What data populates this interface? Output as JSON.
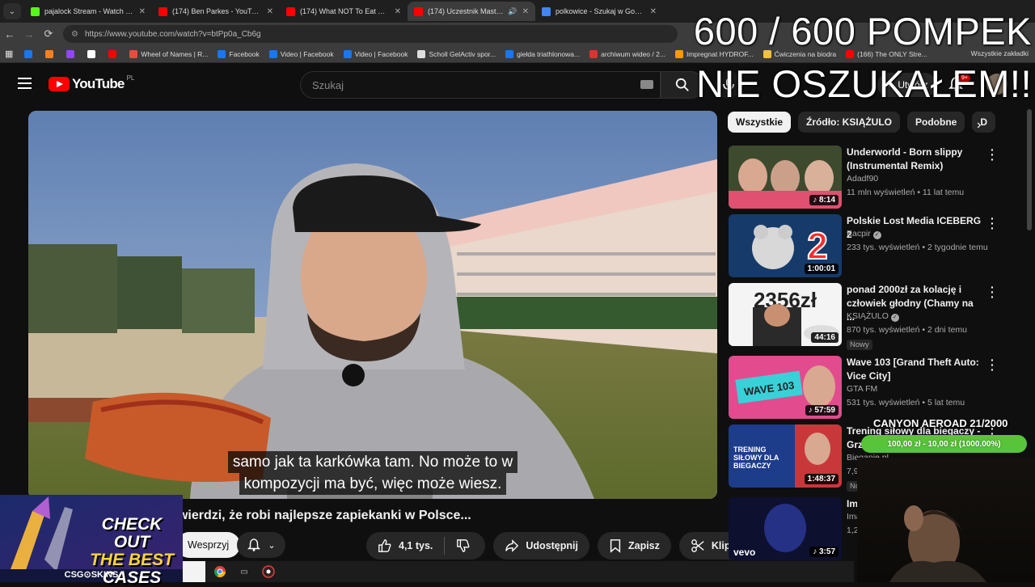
{
  "browser": {
    "tabs": [
      {
        "title": "pajalock Stream - Watch Live o",
        "favicon_color": "#53fc18",
        "active": false
      },
      {
        "title": "(174) Ben Parkes - YouTube",
        "favicon_color": "#ff0000",
        "active": false
      },
      {
        "title": "(174) What NOT To Eat Before",
        "favicon_color": "#ff0000",
        "active": false
      },
      {
        "title": "(174) Uczestnik MasterChef",
        "favicon_color": "#ff0000",
        "active": true
      },
      {
        "title": "polkowice - Szukaj w Google",
        "favicon_color": "#4285f4",
        "active": false
      }
    ],
    "url": "https://www.youtube.com/watch?v=btPp0a_Cb6g",
    "bookmarks": [
      {
        "label": "",
        "favicon_color": "#1877f2"
      },
      {
        "label": "",
        "favicon_color": "#f48024"
      },
      {
        "label": "",
        "favicon_color": "#9146ff"
      },
      {
        "label": "",
        "favicon_color": "#ffffff"
      },
      {
        "label": "",
        "favicon_color": "#ff0000"
      },
      {
        "label": "Wheel of Names | R...",
        "favicon_color": "#e84c3d"
      },
      {
        "label": "Facebook",
        "favicon_color": "#1877f2"
      },
      {
        "label": "Video | Facebook",
        "favicon_color": "#1877f2"
      },
      {
        "label": "Video | Facebook",
        "favicon_color": "#1877f2"
      },
      {
        "label": "Scholl GelActiv spor...",
        "favicon_color": "#dddddd"
      },
      {
        "label": "giełda triathlonowa...",
        "favicon_color": "#1877f2"
      },
      {
        "label": "archiwum wideo / 2...",
        "favicon_color": "#e03030"
      },
      {
        "label": "Impregnat HYDROF...",
        "favicon_color": "#ff9900"
      },
      {
        "label": "Ćwiczenia na biodra",
        "favicon_color": "#f0c040"
      },
      {
        "label": "(166) The ONLY Stre...",
        "favicon_color": "#ff0000"
      }
    ],
    "bookmarks_right": "Wszystkie zakładki"
  },
  "youtube": {
    "logo_text": "YouTube",
    "country_code": "PL",
    "search_placeholder": "Szukaj",
    "create_label": "Utwórz",
    "notifications_badge": "9+"
  },
  "stream_overlay": {
    "title_line1": "600 / 600 POMPEK",
    "title_line2": "NIE OSZUKAŁEM!!",
    "canyon_label": "CANYON AEROAD 21/2000",
    "progress_text": "100,00 zł - 10,00 zł (1000.00%)",
    "csgo_headline_1": "CHECK OUT",
    "csgo_headline_2": "THE BEST",
    "csgo_headline_3": "CASES",
    "csgo_brand": "CSG⊙SKINS"
  },
  "video": {
    "subtitle_line1": "samo jak ta karkówka tam. No może to w",
    "subtitle_line2": "kompozycji ma być, więc może wiesz.",
    "title": "Uczestnik MasterChefa twierdzi, że robi najlepsze zapiekanki w Polsce...",
    "support_label": "Wesprzyj",
    "likes": "4,1 tys.",
    "share_label": "Udostępnij",
    "save_label": "Zapisz",
    "clip_label": "Klip"
  },
  "chips": [
    "Wszystkie",
    "Źródło: KSIĄŻULO",
    "Podobne",
    "D"
  ],
  "recommendations": [
    {
      "title": "Underworld - Born slippy (Instrumental Remix)",
      "channel": "Adadf90",
      "meta": "11 mln wyświetleń • 11 lat temu",
      "duration": "8:14",
      "verified": false,
      "badge": ""
    },
    {
      "title": "Polskie Lost Media ICEBERG 2",
      "channel": "Kacpir",
      "meta": "233 tys. wyświetleń • 2 tygodnie temu",
      "duration": "1:00:01",
      "verified": true,
      "badge": ""
    },
    {
      "title": "ponad 2000zł za kolację i człowiek głodny (Chamy na ...",
      "channel": "KSIĄŻULO",
      "meta": "870 tys. wyświetleń • 2 dni temu",
      "duration": "44:16",
      "verified": true,
      "badge": "Nowy"
    },
    {
      "title": "Wave 103 [Grand Theft Auto: Vice City]",
      "channel": "GTA FM",
      "meta": "531 tys. wyświetleń • 5 lat temu",
      "duration": "57:59",
      "verified": false,
      "badge": ""
    },
    {
      "title": "Trening siłowy dla biegaczy - Grz...",
      "channel": "Bieganie.pl",
      "meta": "7,9",
      "duration": "1:48:37",
      "verified": false,
      "badge": "No"
    },
    {
      "title": "Im...",
      "channel": "Ima",
      "meta": "1,2",
      "duration": "3:57",
      "verified": false,
      "badge": ""
    }
  ],
  "thumb_texts": {
    "t2_number": "2",
    "t3_text": "2356zł",
    "t4_text": "WAVE 103",
    "t5_text": "TRENING SIŁOWY DLA BIEGACZY",
    "t6_logo": "vevo"
  }
}
